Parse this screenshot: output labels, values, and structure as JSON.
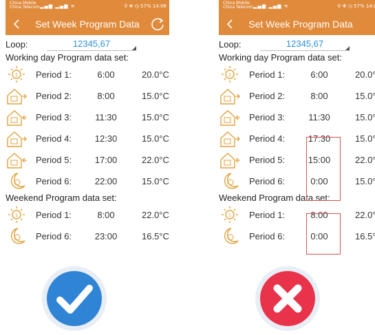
{
  "status": {
    "left_carrier": "China Mobile\nChina Telecom",
    "left_info": "⚲ ✻ ◷ 57% 14:06",
    "right_carrier": "China Mobile\nChina Telecom",
    "right_info": "⚲ ✻ ◷ 57% 14:08"
  },
  "appbar": {
    "title": "Set Week Program Data"
  },
  "loop": {
    "label": "Loop:",
    "value": "12345,67"
  },
  "sections": {
    "working": "Working day Program data set:",
    "weekend": "Weekend Program data set:"
  },
  "left": {
    "working": [
      {
        "label": "Period 1:",
        "time": "6:00",
        "temp": "20.0°C",
        "icon": "sun-icon"
      },
      {
        "label": "Period 2:",
        "time": "8:00",
        "temp": "15.0°C",
        "icon": "house-leave-icon"
      },
      {
        "label": "Period 3:",
        "time": "11:30",
        "temp": "15.0°C",
        "icon": "house-return-icon"
      },
      {
        "label": "Period 4:",
        "time": "12:30",
        "temp": "15.0°C",
        "icon": "house-leave-icon"
      },
      {
        "label": "Period 5:",
        "time": "17:00",
        "temp": "22.0°C",
        "icon": "house-return-icon"
      },
      {
        "label": "Period 6:",
        "time": "22:00",
        "temp": "15.0°C",
        "icon": "moon-icon"
      }
    ],
    "weekend": [
      {
        "label": "Period 1:",
        "time": "8:00",
        "temp": "22.0°C",
        "icon": "sun-icon"
      },
      {
        "label": "Period 6:",
        "time": "23:00",
        "temp": "16.5°C",
        "icon": "moon-icon"
      }
    ]
  },
  "right": {
    "working": [
      {
        "label": "Period 1:",
        "time": "6:00",
        "temp": "20.0°",
        "icon": "sun-icon"
      },
      {
        "label": "Period 2:",
        "time": "8:00",
        "temp": "15.0°",
        "icon": "house-leave-icon"
      },
      {
        "label": "Period 3:",
        "time": "11:30",
        "temp": "15.0°",
        "icon": "house-return-icon"
      },
      {
        "label": "Period 4:",
        "time": "17:30",
        "temp": "15.0°",
        "icon": "house-leave-icon"
      },
      {
        "label": "Period 5:",
        "time": "15:00",
        "temp": "22.0°",
        "icon": "house-return-icon"
      },
      {
        "label": "Period 6:",
        "time": "0:00",
        "temp": "15.0°",
        "icon": "moon-icon"
      }
    ],
    "weekend": [
      {
        "label": "Period 1:",
        "time": "8:00",
        "temp": "22.0°",
        "icon": "sun-icon"
      },
      {
        "label": "Period 6:",
        "time": "0:00",
        "temp": "16.5°",
        "icon": "moon-icon"
      }
    ]
  },
  "colors": {
    "accent": "#e08a3c",
    "loop_value": "#2a8fd8",
    "ok": "#2f84d6",
    "error": "#e8334a",
    "highlight": "#d9534f"
  },
  "buttons": {
    "left_icon": "checkmark-icon",
    "right_icon": "cross-icon"
  }
}
